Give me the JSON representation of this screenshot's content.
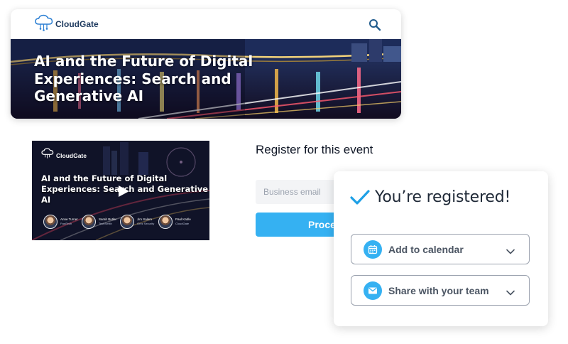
{
  "site": {
    "logo_text": "CloudGate",
    "hero_title": "AI and the Future of Digital Experiences: Search and Generative AI"
  },
  "video": {
    "logo_text": "CloudGate",
    "title": "AI and the Future of Digital Experiences: Search and Generative AI",
    "speakers": [
      {
        "name": "Anne Turner",
        "company": "FastTech"
      },
      {
        "name": "Sarah Butler",
        "company": "TechSmith"
      },
      {
        "name": "Jim Salem",
        "company": "Grez Security"
      },
      {
        "name": "Paul Kable",
        "company": "CloudGate"
      }
    ]
  },
  "registration": {
    "heading": "Register for this event",
    "email_placeholder": "Business email",
    "proceed_label": "Proceed"
  },
  "confirmation": {
    "title": "You’re registered!",
    "add_calendar_label": "Add to calendar",
    "share_label": "Share with your team"
  },
  "colors": {
    "accent": "#35b1f2",
    "logo_blue": "#1e3a5f",
    "check_blue": "#1ea0e6"
  },
  "icons": {
    "search": "search-icon",
    "logo": "cloud-logo-icon",
    "play": "play-icon",
    "check": "check-icon",
    "calendar": "calendar-icon",
    "mail": "mail-icon",
    "chevron": "chevron-down-icon"
  }
}
